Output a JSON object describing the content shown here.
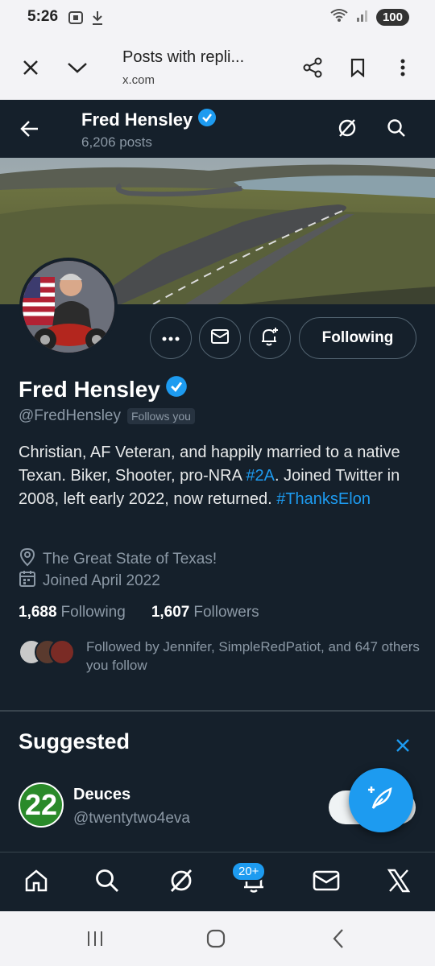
{
  "status": {
    "time": "5:26",
    "battery": "100"
  },
  "browser": {
    "title": "Posts with repli...",
    "url": "x.com"
  },
  "header": {
    "name": "Fred Hensley",
    "posts_count": "6,206 posts"
  },
  "profile": {
    "name": "Fred Hensley",
    "handle": "@FredHensley",
    "follows_you": "Follows you",
    "following_button": "Following",
    "bio_text_1": "Christian, AF Veteran, and happily married to a native Texan. Biker, Shooter, pro-NRA ",
    "bio_tag_1": "#2A",
    "bio_text_2": ". Joined Twitter in 2008, left early 2022, now returned. ",
    "bio_tag_2": "#ThanksElon",
    "location": "The Great State of Texas!",
    "joined": "Joined April 2022",
    "following_count": "1,688",
    "following_label": "Following",
    "followers_count": "1,607",
    "followers_label": "Followers",
    "followed_by": "Followed by Jennifer, SimpleRedPatiot, and 647 others you follow"
  },
  "suggested": {
    "title": "Suggested",
    "user_avatar_text": "22",
    "user_name": "Deuces",
    "user_handle": "@twentytwo4eva"
  },
  "tabbar": {
    "notification_badge": "20+"
  },
  "colors": {
    "background": "#15202b",
    "accent": "#1d9bf0",
    "secondary_text": "#8b98a5"
  }
}
